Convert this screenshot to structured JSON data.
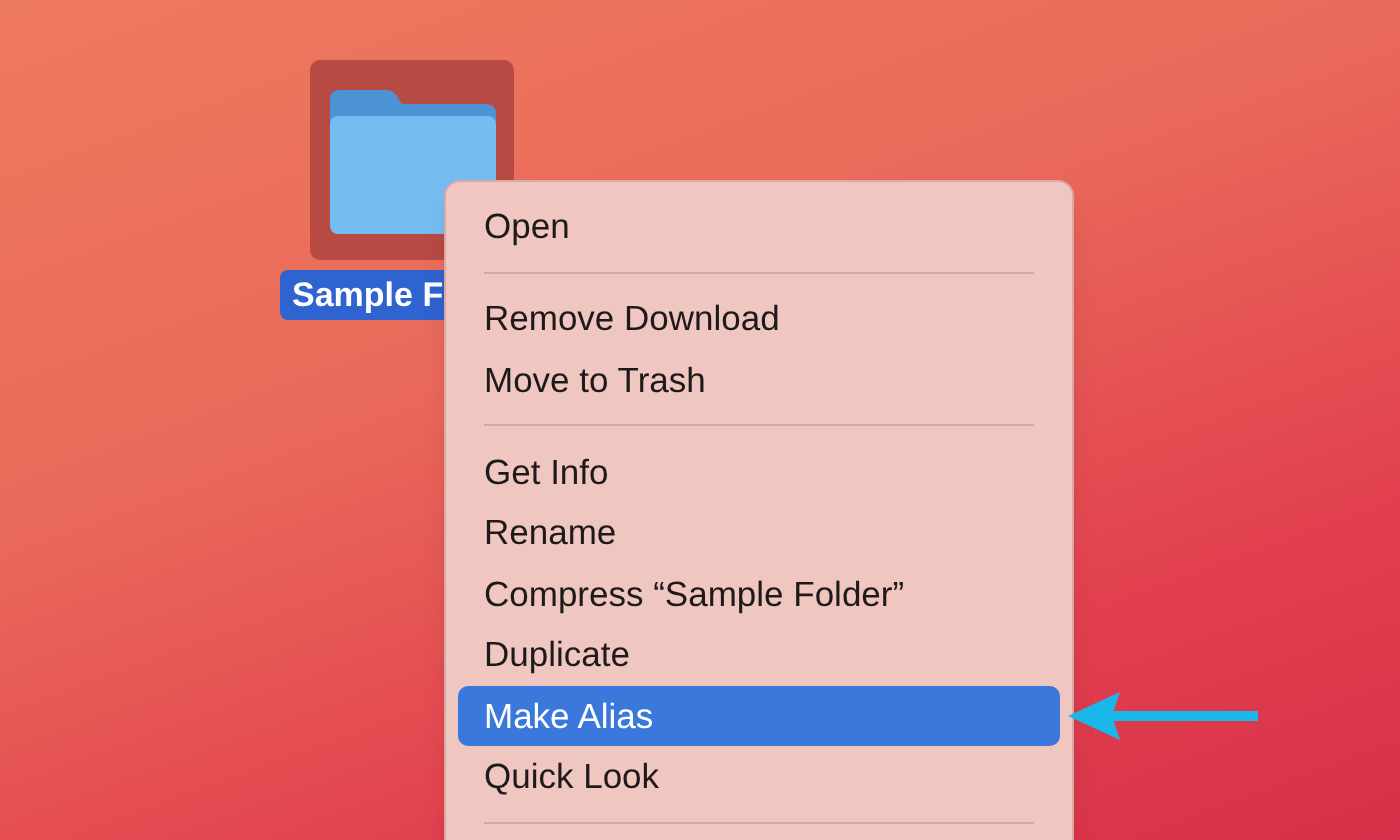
{
  "desktop": {
    "folder": {
      "label": "Sample F",
      "selected": true
    }
  },
  "context_menu": {
    "items": [
      {
        "kind": "item",
        "label": "Open",
        "selected": false
      },
      {
        "kind": "separator"
      },
      {
        "kind": "item",
        "label": "Remove Download",
        "selected": false
      },
      {
        "kind": "item",
        "label": "Move to Trash",
        "selected": false
      },
      {
        "kind": "separator"
      },
      {
        "kind": "item",
        "label": "Get Info",
        "selected": false
      },
      {
        "kind": "item",
        "label": "Rename",
        "selected": false
      },
      {
        "kind": "item",
        "label": "Compress “Sample Folder”",
        "selected": false
      },
      {
        "kind": "item",
        "label": "Duplicate",
        "selected": false
      },
      {
        "kind": "item",
        "label": "Make Alias",
        "selected": true
      },
      {
        "kind": "item",
        "label": "Quick Look",
        "selected": false
      },
      {
        "kind": "separator"
      }
    ]
  }
}
